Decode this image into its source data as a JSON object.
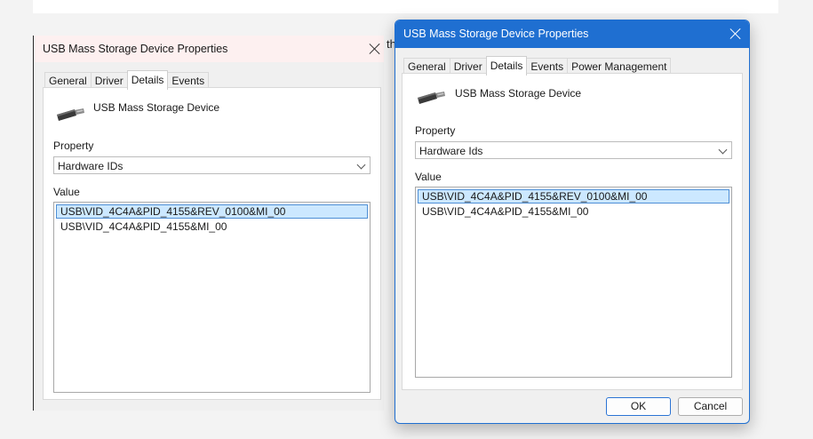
{
  "background_text": "th",
  "dialogs": [
    {
      "title": "USB Mass Storage Device Properties",
      "tabs": [
        "General",
        "Driver",
        "Details",
        "Events"
      ],
      "active_tab": "Details",
      "device_name": "USB Mass Storage Device",
      "property_label": "Property",
      "property_value": "Hardware IDs",
      "value_label": "Value",
      "values": [
        "USB\\VID_4C4A&PID_4155&REV_0100&MI_00",
        "USB\\VID_4C4A&PID_4155&MI_00"
      ],
      "selected_index": 0
    },
    {
      "title": "USB Mass Storage Device Properties",
      "tabs": [
        "General",
        "Driver",
        "Details",
        "Events",
        "Power Management"
      ],
      "active_tab": "Details",
      "device_name": "USB Mass Storage Device",
      "property_label": "Property",
      "property_value": "Hardware Ids",
      "value_label": "Value",
      "values": [
        "USB\\VID_4C4A&PID_4155&REV_0100&MI_00",
        "USB\\VID_4C4A&PID_4155&MI_00"
      ],
      "selected_index": 0,
      "ok_label": "OK",
      "cancel_label": "Cancel"
    }
  ],
  "colors": {
    "titlebar_active": "#1f6fd1",
    "selection_fill": "#cce8ff",
    "selection_border": "#4e8fd6"
  },
  "icons": [
    "close-icon",
    "usb-drive-icon",
    "chevron-down-icon"
  ]
}
